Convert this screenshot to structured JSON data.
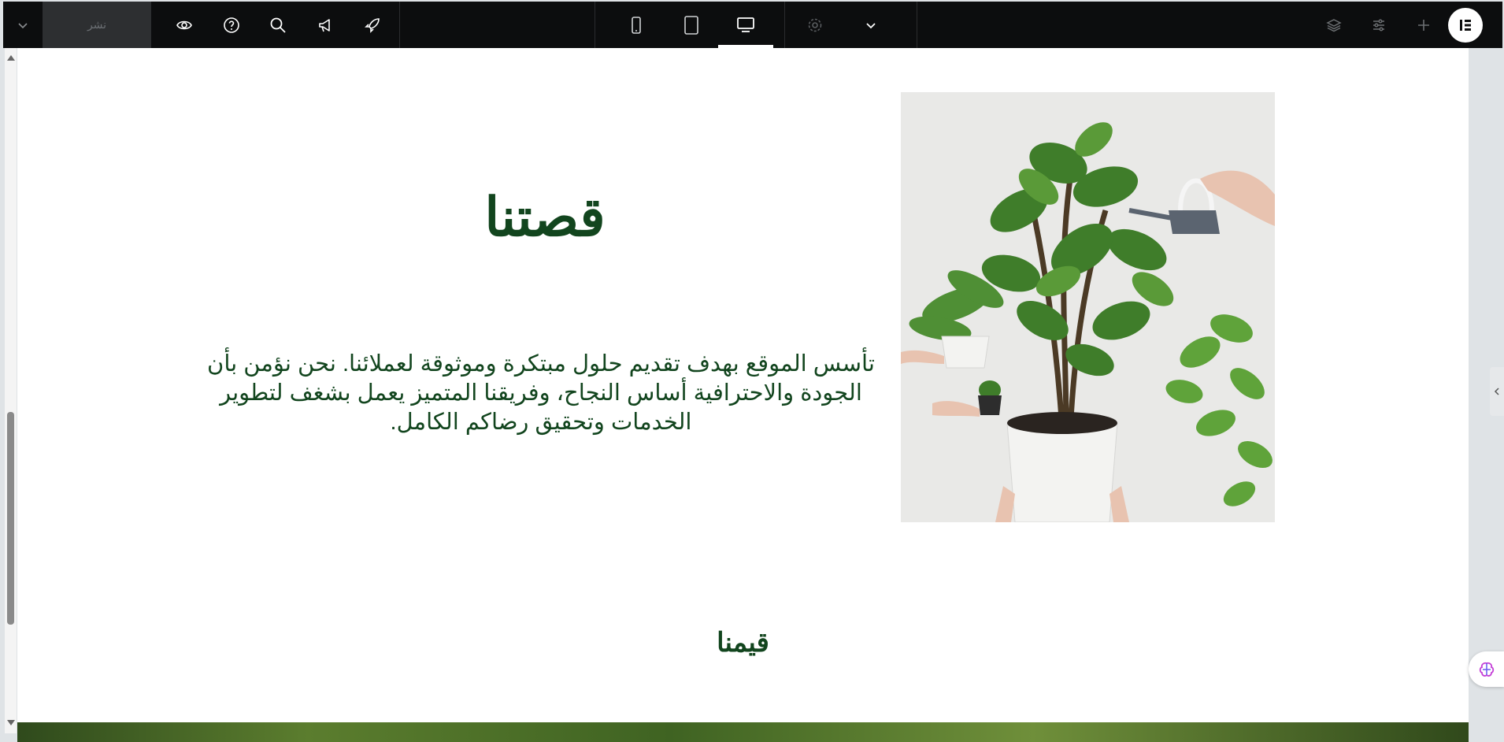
{
  "toolbar": {
    "publish_label": "نشر",
    "icons": {
      "expand": "chevron-down-icon",
      "preview": "eye-icon",
      "help": "question-icon",
      "search": "search-icon",
      "notifications": "megaphone-icon",
      "launch": "rocket-icon",
      "mobile": "mobile-icon",
      "tablet": "tablet-icon",
      "desktop": "desktop-icon",
      "settings": "gear-icon",
      "more": "chevron-down-icon",
      "structure": "layers-icon",
      "site_settings": "sliders-icon",
      "add": "plus-icon",
      "logo": "elementor-logo-icon"
    },
    "active_device": "desktop"
  },
  "page": {
    "heading": "قصتنا",
    "paragraph": "تأسس الموقع بهدف تقديم حلول مبتكرة وموثوقة لعملائنا. نحن نؤمن بأن الجودة والاحترافية أساس النجاح، وفريقنا المتميز يعمل بشغف لتطوير الخدمات وتحقيق رضاكم الكامل.",
    "values_heading": "قيمنا"
  },
  "colors": {
    "toolbar_bg": "#0c0d0e",
    "text_green": "#12451e"
  }
}
